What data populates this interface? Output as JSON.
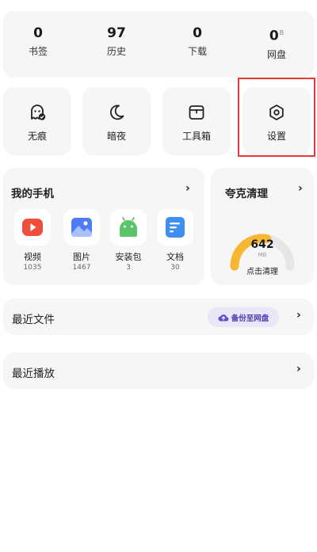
{
  "stats": [
    {
      "value": "0",
      "label": "书签"
    },
    {
      "value": "97",
      "label": "历史"
    },
    {
      "value": "0",
      "label": "下载"
    },
    {
      "value": "0",
      "badge": "B",
      "label": "网盘"
    }
  ],
  "quick_actions": [
    {
      "label": "无痕",
      "icon": "ghost-icon"
    },
    {
      "label": "暗夜",
      "icon": "moon-icon"
    },
    {
      "label": "工具箱",
      "icon": "toolbox-icon"
    },
    {
      "label": "设置",
      "icon": "settings-icon"
    }
  ],
  "my_phone": {
    "title": "我的手机",
    "chevron": "›",
    "items": [
      {
        "name": "视频",
        "count": "1035",
        "icon": "video-icon",
        "color": "#ee4f3c"
      },
      {
        "name": "图片",
        "count": "1467",
        "icon": "image-icon",
        "color": "#4d7cf5"
      },
      {
        "name": "安装包",
        "count": "3",
        "icon": "android-icon",
        "color": "#5cc56b"
      },
      {
        "name": "文档",
        "count": "30",
        "icon": "document-icon",
        "color": "#3d8ff2"
      }
    ]
  },
  "cleaner": {
    "title": "夸克清理",
    "chevron": "›",
    "value": "642",
    "unit": "MB",
    "action": "点击清理",
    "gauge_fraction": 0.55,
    "gauge_color": "#f7b731"
  },
  "recent_files": {
    "label": "最近文件",
    "backup": "备份至网盘",
    "chevron": "›"
  },
  "recent_play": {
    "label": "最近播放",
    "chevron": "›"
  }
}
